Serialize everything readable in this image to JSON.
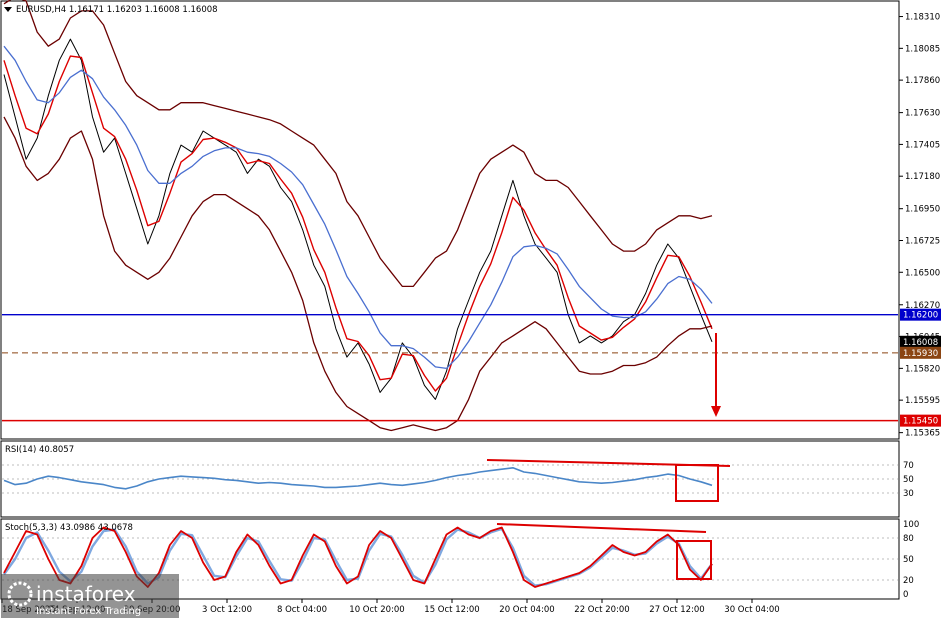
{
  "header": {
    "symbol_line": "EURUSD,H4  1.16171 1.16203 1.16008 1.16008",
    "rsi_line": "RSI(14) 40.8057",
    "stoch_line": "Stoch(5,3,3) 43.0986 43.0678"
  },
  "watermark": {
    "brand": "instaforex",
    "tagline": "Instant Forex Trading"
  },
  "chart_data": [
    {
      "type": "line",
      "panel": "price",
      "title": "EURUSD,H4",
      "ohlc_last": {
        "open": 1.16171,
        "high": 1.16203,
        "low": 1.16008,
        "close": 1.16008
      },
      "y_ticks": [
        "1.18310",
        "1.18085",
        "1.17860",
        "1.17630",
        "1.17405",
        "1.17180",
        "1.16950",
        "1.16725",
        "1.16500",
        "1.16270",
        "1.16045",
        "1.15820",
        "1.15595",
        "1.15365"
      ],
      "ylim": [
        1.1532,
        1.1842
      ],
      "x_ticks": [
        "18 Sep 2025",
        "24 Sep 12:00",
        "30 Sep 20:00",
        "3 Oct 12:00",
        "8 Oct 04:00",
        "10 Oct 20:00",
        "15 Oct 12:00",
        "20 Oct 04:00",
        "22 Oct 20:00",
        "27 Oct 12:00",
        "30 Oct 04:00"
      ],
      "levels": [
        {
          "label": "1.16200",
          "value": 1.162,
          "color": "#0000cc",
          "style": "solid"
        },
        {
          "label": "1.16008",
          "value": 1.16008,
          "color": "#000000",
          "style": "price-tag"
        },
        {
          "label": "1.15930",
          "value": 1.1593,
          "color": "#8b4513",
          "style": "dashed"
        },
        {
          "label": "1.15450",
          "value": 1.1545,
          "color": "#dd0000",
          "style": "solid"
        }
      ],
      "series": [
        {
          "kind": "close",
          "color": "#000000",
          "values": [
            1.179,
            1.176,
            1.173,
            1.1745,
            1.1775,
            1.18,
            1.1815,
            1.18,
            1.176,
            1.1735,
            1.1745,
            1.172,
            1.1695,
            1.167,
            1.169,
            1.172,
            1.174,
            1.1735,
            1.175,
            1.1745,
            1.174,
            1.1735,
            1.172,
            1.173,
            1.1725,
            1.171,
            1.17,
            1.168,
            1.1655,
            1.164,
            1.161,
            1.159,
            1.16,
            1.1585,
            1.1565,
            1.1575,
            1.16,
            1.159,
            1.157,
            1.156,
            1.158,
            1.161,
            1.163,
            1.165,
            1.1665,
            1.169,
            1.1715,
            1.169,
            1.167,
            1.166,
            1.165,
            1.162,
            1.16,
            1.1605,
            1.16,
            1.1605,
            1.1615,
            1.162,
            1.1635,
            1.1655,
            1.167,
            1.166,
            1.164,
            1.162,
            1.16008
          ]
        },
        {
          "kind": "fast_ma",
          "color": "#dd0000",
          "values": [
            1.18,
            1.1775,
            1.1752,
            1.1748,
            1.1762,
            1.1785,
            1.1803,
            1.1802,
            1.1777,
            1.1752,
            1.1746,
            1.173,
            1.1708,
            1.1683,
            1.1686,
            1.1706,
            1.1728,
            1.1734,
            1.1744,
            1.1745,
            1.1742,
            1.1738,
            1.1727,
            1.1729,
            1.1727,
            1.1716,
            1.1706,
            1.1689,
            1.1666,
            1.165,
            1.1625,
            1.1603,
            1.1601,
            1.1591,
            1.1574,
            1.1575,
            1.1592,
            1.1591,
            1.1577,
            1.1566,
            1.1575,
            1.1598,
            1.162,
            1.164,
            1.1656,
            1.1678,
            1.1703,
            1.1694,
            1.1678,
            1.1666,
            1.1655,
            1.1632,
            1.1612,
            1.1607,
            1.1602,
            1.1604,
            1.1611,
            1.1617,
            1.1629,
            1.1646,
            1.1662,
            1.1661,
            1.1647,
            1.1629,
            1.161
          ]
        },
        {
          "kind": "slow_ma",
          "color": "#4a6fd0",
          "values": [
            1.181,
            1.18,
            1.1785,
            1.1772,
            1.177,
            1.1777,
            1.1788,
            1.1793,
            1.1787,
            1.1774,
            1.1765,
            1.1754,
            1.174,
            1.1722,
            1.1713,
            1.1713,
            1.172,
            1.1725,
            1.1732,
            1.1736,
            1.1738,
            1.1738,
            1.1735,
            1.1734,
            1.1732,
            1.1727,
            1.1721,
            1.1712,
            1.1698,
            1.1684,
            1.1666,
            1.1647,
            1.1635,
            1.1622,
            1.1607,
            1.1598,
            1.1598,
            1.1596,
            1.159,
            1.1583,
            1.1582,
            1.159,
            1.1601,
            1.1614,
            1.1627,
            1.1643,
            1.1661,
            1.1668,
            1.1669,
            1.1667,
            1.1663,
            1.1652,
            1.164,
            1.1632,
            1.1624,
            1.1619,
            1.1618,
            1.1618,
            1.1622,
            1.1631,
            1.1642,
            1.1647,
            1.1645,
            1.1638,
            1.1628
          ]
        },
        {
          "kind": "upper_band",
          "color": "#6b0000",
          "values": [
            1.184,
            1.1845,
            1.1842,
            1.182,
            1.181,
            1.1815,
            1.183,
            1.1835,
            1.1835,
            1.1825,
            1.1805,
            1.1785,
            1.1775,
            1.177,
            1.1765,
            1.1765,
            1.177,
            1.177,
            1.177,
            1.1768,
            1.1766,
            1.1764,
            1.1762,
            1.176,
            1.1758,
            1.1755,
            1.175,
            1.1745,
            1.174,
            1.173,
            1.172,
            1.17,
            1.169,
            1.1675,
            1.166,
            1.165,
            1.164,
            1.164,
            1.165,
            1.166,
            1.1665,
            1.168,
            1.17,
            1.172,
            1.173,
            1.1735,
            1.174,
            1.1735,
            1.172,
            1.1715,
            1.1715,
            1.171,
            1.17,
            1.169,
            1.168,
            1.167,
            1.1665,
            1.1665,
            1.167,
            1.168,
            1.1685,
            1.169,
            1.169,
            1.1688,
            1.169
          ]
        },
        {
          "kind": "lower_band",
          "color": "#6b0000",
          "values": [
            1.176,
            1.1745,
            1.1725,
            1.1715,
            1.172,
            1.173,
            1.1745,
            1.175,
            1.173,
            1.169,
            1.1665,
            1.1655,
            1.165,
            1.1645,
            1.165,
            1.166,
            1.1675,
            1.169,
            1.17,
            1.1705,
            1.1705,
            1.17,
            1.1695,
            1.169,
            1.168,
            1.1665,
            1.165,
            1.163,
            1.16,
            1.158,
            1.1565,
            1.1555,
            1.155,
            1.1545,
            1.154,
            1.1538,
            1.154,
            1.1542,
            1.154,
            1.1538,
            1.154,
            1.1545,
            1.156,
            1.158,
            1.159,
            1.16,
            1.1605,
            1.161,
            1.1615,
            1.161,
            1.16,
            1.159,
            1.158,
            1.1578,
            1.1578,
            1.158,
            1.1584,
            1.1584,
            1.1586,
            1.159,
            1.1598,
            1.1605,
            1.161,
            1.161,
            1.1612
          ]
        }
      ]
    },
    {
      "type": "line",
      "panel": "rsi",
      "title": "RSI(14) 40.8057",
      "y_ticks": [
        "70",
        "50",
        "30"
      ],
      "ylim": [
        0,
        100
      ],
      "series": [
        {
          "kind": "rsi",
          "color": "#4a86c8",
          "values": [
            48,
            42,
            44,
            50,
            54,
            52,
            49,
            46,
            44,
            42,
            38,
            36,
            40,
            46,
            50,
            52,
            54,
            53,
            52,
            51,
            49,
            48,
            46,
            44,
            45,
            44,
            42,
            41,
            40,
            38,
            38,
            39,
            40,
            42,
            44,
            42,
            41,
            43,
            45,
            48,
            52,
            55,
            57,
            60,
            62,
            64,
            66,
            60,
            58,
            55,
            52,
            49,
            46,
            45,
            44,
            45,
            47,
            49,
            52,
            54,
            57,
            55,
            50,
            46,
            41
          ]
        }
      ]
    },
    {
      "type": "line",
      "panel": "stochastic",
      "title": "Stoch(5,3,3) 43.0986 43.0678",
      "y_ticks": [
        "100",
        "80",
        "50",
        "20",
        "0"
      ],
      "ylim": [
        0,
        100
      ],
      "series": [
        {
          "kind": "main",
          "color": "#dd0000",
          "values": [
            30,
            60,
            90,
            85,
            50,
            20,
            15,
            40,
            80,
            95,
            90,
            60,
            25,
            10,
            30,
            70,
            90,
            80,
            45,
            20,
            25,
            60,
            85,
            70,
            40,
            15,
            20,
            55,
            85,
            75,
            40,
            15,
            25,
            70,
            90,
            80,
            50,
            20,
            15,
            50,
            85,
            95,
            85,
            80,
            90,
            95,
            60,
            20,
            10,
            15,
            20,
            25,
            30,
            40,
            55,
            70,
            60,
            55,
            60,
            75,
            85,
            70,
            35,
            20,
            43
          ]
        },
        {
          "kind": "signal",
          "color": "#7fa8e0",
          "values": [
            28,
            50,
            80,
            88,
            62,
            32,
            18,
            32,
            68,
            90,
            92,
            68,
            32,
            15,
            24,
            62,
            86,
            84,
            55,
            26,
            24,
            54,
            80,
            75,
            47,
            21,
            19,
            47,
            80,
            78,
            48,
            20,
            22,
            62,
            86,
            82,
            56,
            26,
            16,
            42,
            78,
            92,
            88,
            80,
            88,
            93,
            66,
            26,
            12,
            14,
            19,
            24,
            29,
            38,
            52,
            66,
            62,
            56,
            58,
            72,
            82,
            72,
            40,
            22,
            43
          ]
        }
      ]
    }
  ]
}
